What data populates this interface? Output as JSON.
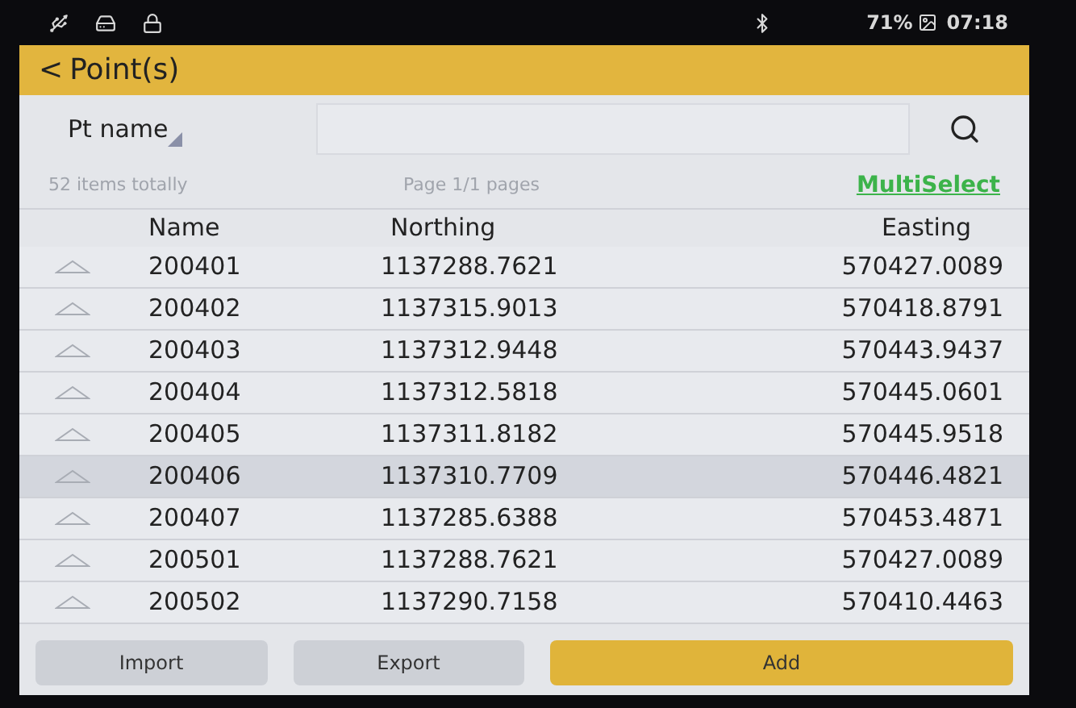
{
  "status_bar": {
    "battery": "71%",
    "time": "07:18"
  },
  "header": {
    "back": "<",
    "title": "Point(s)"
  },
  "search": {
    "filter": "Pt name"
  },
  "info": {
    "count": "52 items totally",
    "page": "Page 1/1 pages",
    "multiselect": "MultiSelect"
  },
  "table": {
    "columns": [
      "Name",
      "Northing",
      "Easting"
    ],
    "rows": [
      {
        "name": "200401",
        "northing": "1137288.7621",
        "easting": "570427.0089",
        "selected": false
      },
      {
        "name": "200402",
        "northing": "1137315.9013",
        "easting": "570418.8791",
        "selected": false
      },
      {
        "name": "200403",
        "northing": "1137312.9448",
        "easting": "570443.9437",
        "selected": false
      },
      {
        "name": "200404",
        "northing": "1137312.5818",
        "easting": "570445.0601",
        "selected": false
      },
      {
        "name": "200405",
        "northing": "1137311.8182",
        "easting": "570445.9518",
        "selected": false
      },
      {
        "name": "200406",
        "northing": "1137310.7709",
        "easting": "570446.4821",
        "selected": true
      },
      {
        "name": "200407",
        "northing": "1137285.6388",
        "easting": "570453.4871",
        "selected": false
      },
      {
        "name": "200501",
        "northing": "1137288.7621",
        "easting": "570427.0089",
        "selected": false
      },
      {
        "name": "200502",
        "northing": "1137290.7158",
        "easting": "570410.4463",
        "selected": false
      }
    ]
  },
  "buttons": [
    {
      "label": "Import",
      "kind": "secondary"
    },
    {
      "label": "Export",
      "kind": "secondary"
    },
    {
      "label": "Add",
      "kind": "primary"
    }
  ]
}
